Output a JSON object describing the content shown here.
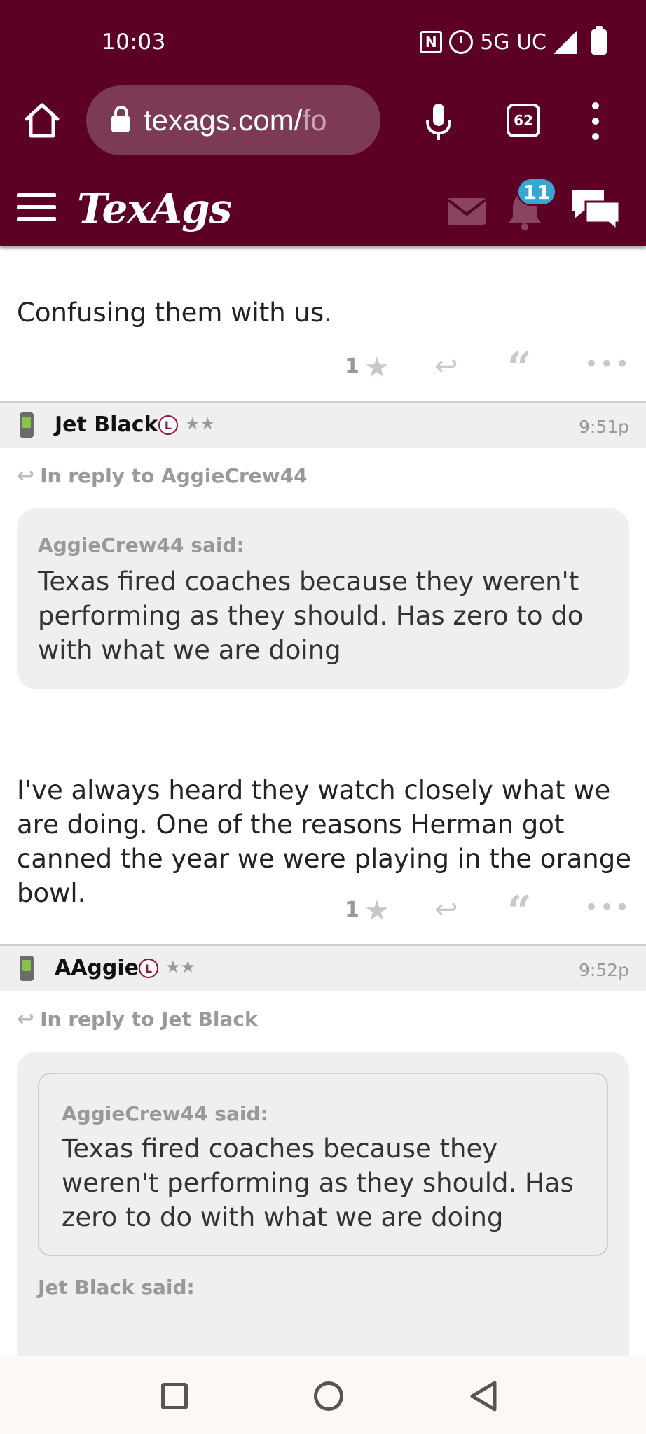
{
  "status_bar": {
    "time": "10:03",
    "network": "5G UC",
    "icons": [
      "nfc-icon",
      "alarm-icon",
      "signal-icon",
      "battery-icon"
    ]
  },
  "browser": {
    "url_main": "texags.com/",
    "url_faded": "fo",
    "tab_count": "62",
    "icons": [
      "home-icon",
      "lock-icon",
      "mic-icon",
      "tabs-icon",
      "more-vert-icon"
    ]
  },
  "site_header": {
    "logo": "TexAgs",
    "notification_count": "11",
    "icons": [
      "menu-icon",
      "mail-icon",
      "bell-icon",
      "chat-icon"
    ]
  },
  "posts": [
    {
      "body": "Confusing them with us.",
      "star_count": "1"
    },
    {
      "author": "Jet Black",
      "level_badge": "L",
      "stars": "★★",
      "time": "9:51p",
      "reply_to": "In reply to AggieCrew44",
      "quote_author": "AggieCrew44 said:",
      "quote_text": "Texas fired coaches because they weren't performing as they should. Has zero to do with what we are doing",
      "body": "I've always heard they watch closely what we are doing. One of the reasons Herman got canned the year we were playing in the orange bowl.",
      "star_count": "1"
    },
    {
      "author": "AAggie",
      "level_badge": "L",
      "stars": "★★",
      "time": "9:52p",
      "reply_to": "In reply to Jet Black",
      "nested_quote_author": "AggieCrew44 said:",
      "nested_quote_text": "Texas fired coaches because they weren't performing as they should. Has zero to do with what we are doing",
      "quote_author": "Jet Black said:"
    }
  ],
  "colors": {
    "brand_maroon": "#5c0025",
    "badge_blue": "#38a6d4",
    "muted_gray": "#999999"
  }
}
